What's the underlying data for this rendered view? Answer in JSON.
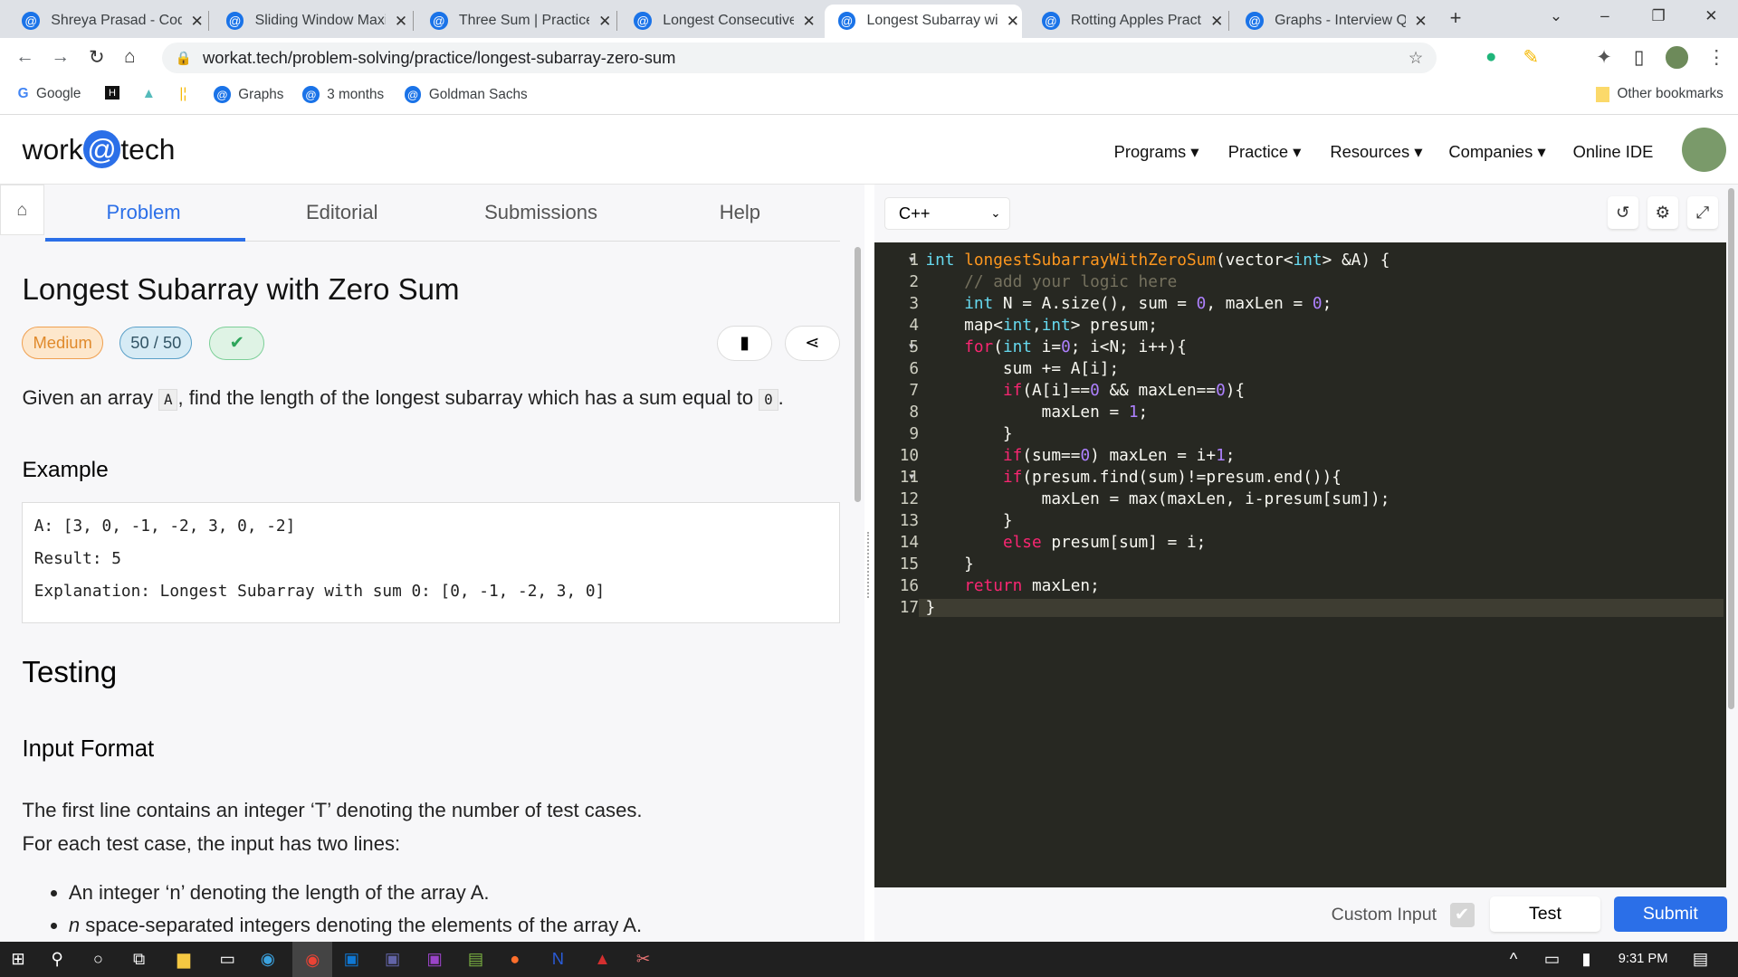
{
  "browser": {
    "tabs": [
      {
        "title": "Shreya Prasad - Coding"
      },
      {
        "title": "Sliding Window Maximum"
      },
      {
        "title": "Three Sum | Practice Problem"
      },
      {
        "title": "Longest Consecutive Sequence"
      },
      {
        "title": "Longest Subarray with Zero Sum",
        "active": true
      },
      {
        "title": "Rotting Apples Practice"
      },
      {
        "title": "Graphs - Interview Questions"
      }
    ],
    "url": "workat.tech/problem-solving/practice/longest-subarray-zero-sum",
    "bookmarks": [
      "Google",
      "Graphs",
      "3 months",
      "Goldman Sachs"
    ],
    "other_bookmarks": "Other bookmarks"
  },
  "site": {
    "logo": {
      "left": "work",
      "at": "@",
      "right": "tech"
    },
    "nav": [
      "Programs",
      "Practice",
      "Resources",
      "Companies",
      "Online IDE"
    ]
  },
  "problem": {
    "tabs": [
      "Problem",
      "Editorial",
      "Submissions",
      "Help"
    ],
    "title": "Longest Subarray with Zero Sum",
    "difficulty": "Medium",
    "score": "50 / 50",
    "desc_pre": "Given an array ",
    "desc_code1": "A",
    "desc_mid": ", find the length of the longest subarray which has a sum equal to ",
    "desc_code2": "0",
    "desc_end": ".",
    "example_heading": "Example",
    "example_lines": [
      "A: [3, 0, -1, -2, 3, 0, -2]",
      "Result: 5",
      "Explanation: Longest Subarray with sum 0: [0, -1, -2, 3, 0]"
    ],
    "testing_heading": "Testing",
    "input_heading": "Input Format",
    "input_p1": "The first line contains an integer ‘T’ denoting the number of test cases.",
    "input_p2": "For each test case, the input has two lines:",
    "bullet1": "An integer ‘n’ denoting the length of the array A.",
    "bullet2_em": "n",
    "bullet2": " space-separated integers denoting the elements of the array A."
  },
  "editor": {
    "language": "C++",
    "code": [
      [
        [
          "k",
          "int "
        ],
        [
          "f",
          "longestSubarrayWithZeroSum"
        ],
        [
          "",
          "(vector<"
        ],
        [
          "k",
          "int"
        ],
        [
          "",
          "> &A) {"
        ]
      ],
      [
        [
          "",
          "    "
        ],
        [
          "c",
          "// add your logic here"
        ]
      ],
      [
        [
          "",
          "    "
        ],
        [
          "k",
          "int"
        ],
        [
          "",
          " N = A.size(), sum = "
        ],
        [
          "n",
          "0"
        ],
        [
          "",
          ", maxLen = "
        ],
        [
          "n",
          "0"
        ],
        [
          "",
          ";"
        ]
      ],
      [
        [
          "",
          "    map<"
        ],
        [
          "k",
          "int"
        ],
        [
          "",
          ","
        ],
        [
          "k",
          "int"
        ],
        [
          "",
          "> presum;"
        ]
      ],
      [
        [
          "",
          "    "
        ],
        [
          "p",
          "for"
        ],
        [
          "",
          "("
        ],
        [
          "k",
          "int"
        ],
        [
          "",
          " i="
        ],
        [
          "n",
          "0"
        ],
        [
          "",
          "; i<N; i++){"
        ]
      ],
      [
        [
          "",
          "        sum += A[i];"
        ]
      ],
      [
        [
          "",
          "        "
        ],
        [
          "p",
          "if"
        ],
        [
          "",
          "(A[i]=="
        ],
        [
          "n",
          "0"
        ],
        [
          "",
          " && maxLen=="
        ],
        [
          "n",
          "0"
        ],
        [
          "",
          "){"
        ]
      ],
      [
        [
          "",
          "            maxLen = "
        ],
        [
          "n",
          "1"
        ],
        [
          "",
          ";"
        ]
      ],
      [
        [
          "",
          "        }"
        ]
      ],
      [
        [
          "",
          "        "
        ],
        [
          "p",
          "if"
        ],
        [
          "",
          "(sum=="
        ],
        [
          "n",
          "0"
        ],
        [
          "",
          ") maxLen = i+"
        ],
        [
          "n",
          "1"
        ],
        [
          "",
          ";"
        ]
      ],
      [
        [
          "",
          "        "
        ],
        [
          "p",
          "if"
        ],
        [
          "",
          "(presum.find(sum)!=presum.end()){"
        ]
      ],
      [
        [
          "",
          "            maxLen = max(maxLen, i-presum[sum]);"
        ]
      ],
      [
        [
          "",
          "        }"
        ]
      ],
      [
        [
          "",
          "        "
        ],
        [
          "p",
          "else"
        ],
        [
          "",
          " presum[sum] = i;"
        ]
      ],
      [
        [
          "",
          "    }"
        ]
      ],
      [
        [
          "",
          "    "
        ],
        [
          "p",
          "return"
        ],
        [
          "",
          " maxLen;"
        ]
      ],
      [
        [
          "",
          "}"
        ]
      ]
    ],
    "custom_input_label": "Custom Input",
    "custom_input_checked": true,
    "test_label": "Test",
    "submit_label": "Submit"
  },
  "taskbar": {
    "time": "9:31 PM"
  },
  "colors": {
    "accent": "#2b6fe8",
    "editor_bg": "#272822",
    "medium": "#f0a050"
  }
}
